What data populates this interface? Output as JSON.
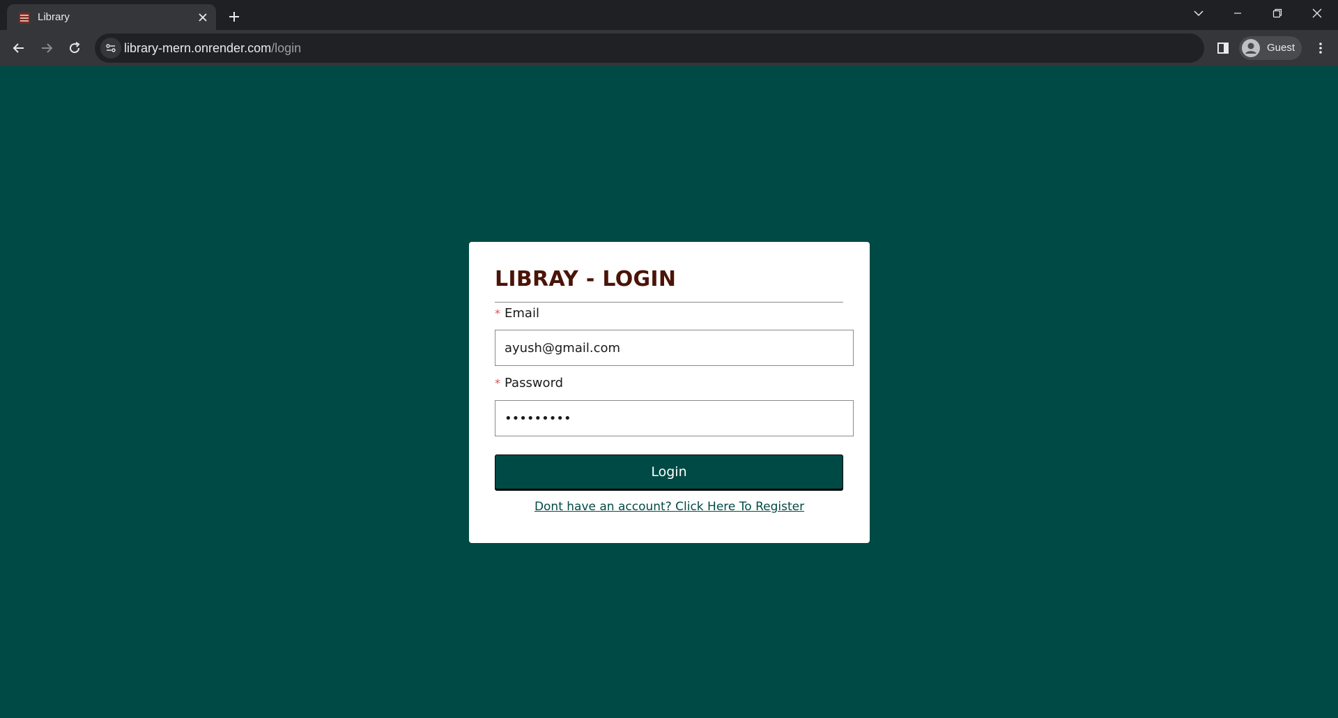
{
  "browser": {
    "tab_title": "Library",
    "url_host": "library-mern.onrender.com",
    "url_path": "/login",
    "profile_name": "Guest"
  },
  "login": {
    "title": "LIBRAY - LOGIN",
    "email_label": "Email",
    "email_value": "ayush@gmail.com",
    "password_label": "Password",
    "password_value": "•••••••••",
    "required_mark": "*",
    "submit_label": "Login",
    "register_link": "Dont have an account? Click Here To Register"
  },
  "colors": {
    "page_background": "#004a45",
    "title": "#4a1408",
    "required": "#e04f4f"
  }
}
